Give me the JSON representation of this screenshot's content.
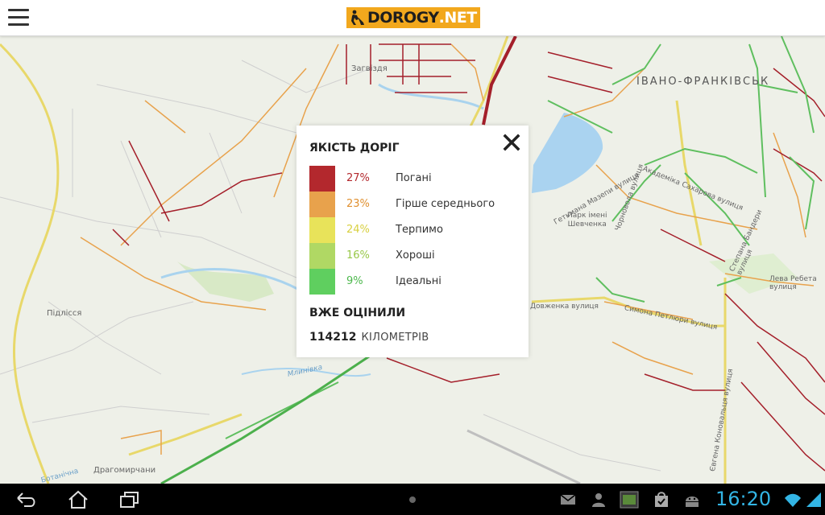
{
  "header": {
    "logo_text": "DOROGY",
    "logo_suffix": ".NET",
    "brand_color": "#f2a81d"
  },
  "map": {
    "labels": {
      "city": "ІВАНО-ФРАНКІВСЬК",
      "zahvizdia": "Загвіздя",
      "pidlissia": "Підлісся",
      "drahomyrchany": "Драгомирчани",
      "park": "Парк імені Шевченка",
      "park_line1": "Парк імені",
      "park_line2": "Шевченка",
      "river": "Млинівка",
      "str_sakharova": "Академіка Сахарова вулиця",
      "str_mazepy": "Гетьмана Мазепи вулиця",
      "str_chornovola": "Чорновола вулиця",
      "str_dovzhenka": "Довженка вулиця",
      "str_petliury": "Симона Петлюри вулиця",
      "str_bandery": "Степана Бандери вулиця",
      "str_rebeta": "Лева Ребета вулиця",
      "str_konovaltsia": "Євгена Коновальця вулиця",
      "str_bottomleft": "Ботанічна"
    }
  },
  "panel": {
    "title": "ЯКІСТЬ ДОРІГ",
    "legend": [
      {
        "percent": "27%",
        "label": "Погані",
        "color": "#b3282d"
      },
      {
        "percent": "23%",
        "label": "Гірше середнього",
        "color": "#e8a24c"
      },
      {
        "percent": "24%",
        "label": "Терпимо",
        "color": "#e8e35a"
      },
      {
        "percent": "16%",
        "label": "Хороші",
        "color": "#b0d864"
      },
      {
        "percent": "9%",
        "label": "Ідеальні",
        "color": "#5fcf5f"
      }
    ],
    "rated_title": "ВЖЕ ОЦІНИЛИ",
    "km_value": "114212",
    "km_unit": "КІЛОМЕТРІВ"
  },
  "statusbar": {
    "time": "16:20",
    "time_color": "#33b5e5"
  }
}
